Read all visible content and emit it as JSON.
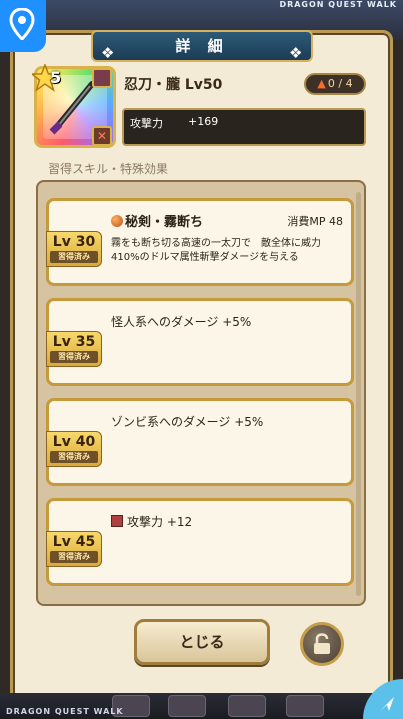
{
  "brand": "DRAGON QUEST WALK",
  "header": {
    "title": "詳 細"
  },
  "weapon": {
    "rarity": "5",
    "name": "忍刀・朧 Lv50",
    "upgrade": "0 / 4",
    "stat_label": "攻撃力",
    "stat_value": "+169"
  },
  "section_title": "習得スキル・特殊効果",
  "skills": [
    {
      "level": "Lv 30",
      "learned": "習得済み",
      "name": "秘剣・霧断ち",
      "mp": "消費MP 48",
      "desc": "霧をも断ち切る高速の一太刀で　敵全体に威力410%のドルマ属性斬撃ダメージを与える"
    },
    {
      "level": "Lv 35",
      "learned": "習得済み",
      "effect": "怪人系へのダメージ +5%"
    },
    {
      "level": "Lv 40",
      "learned": "習得済み",
      "effect": "ゾンビ系へのダメージ +5%"
    },
    {
      "level": "Lv 45",
      "learned": "習得済み",
      "effect": "攻撃力 +12"
    }
  ],
  "buttons": {
    "close": "とじる"
  },
  "icons": {
    "location": "location-pin-icon",
    "lock": "lock-icon",
    "nav": "compass-icon",
    "star": "star-icon",
    "orb": "skill-orb-icon",
    "attack": "attack-up-icon"
  },
  "colors": {
    "panel": "#f4ebd6",
    "gold": "#c49a3c",
    "title_plate": "#2d5a78",
    "accent_blue": "#1e90ff"
  }
}
